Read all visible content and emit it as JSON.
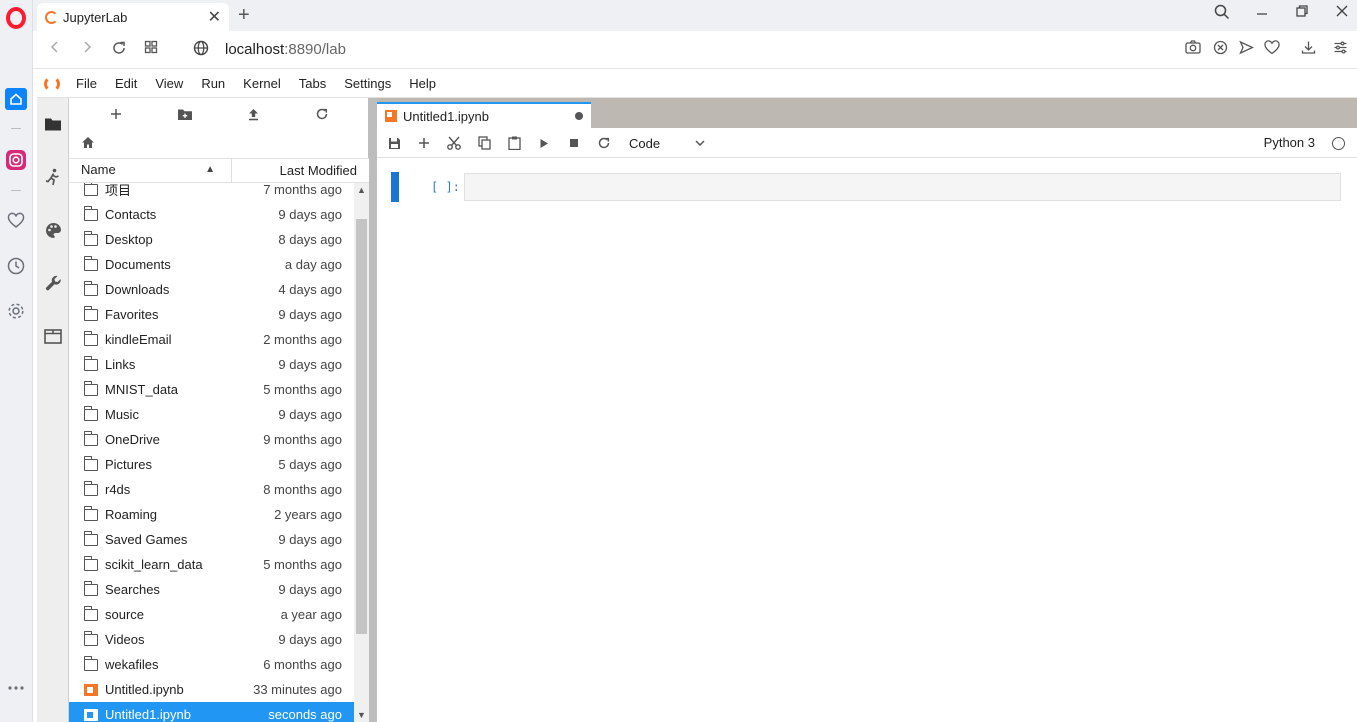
{
  "browser": {
    "tab_title": "JupyterLab",
    "url_host": "localhost",
    "url_rest": ":8890/lab"
  },
  "menubar": {
    "items": [
      "File",
      "Edit",
      "View",
      "Run",
      "Kernel",
      "Tabs",
      "Settings",
      "Help"
    ]
  },
  "filebrowser": {
    "col_name": "Name",
    "col_modified": "Last Modified",
    "rows": [
      {
        "name": "项目",
        "modified": "7 months ago",
        "type": "folder"
      },
      {
        "name": "Contacts",
        "modified": "9 days ago",
        "type": "folder"
      },
      {
        "name": "Desktop",
        "modified": "8 days ago",
        "type": "folder"
      },
      {
        "name": "Documents",
        "modified": "a day ago",
        "type": "folder"
      },
      {
        "name": "Downloads",
        "modified": "4 days ago",
        "type": "folder"
      },
      {
        "name": "Favorites",
        "modified": "9 days ago",
        "type": "folder"
      },
      {
        "name": "kindleEmail",
        "modified": "2 months ago",
        "type": "folder"
      },
      {
        "name": "Links",
        "modified": "9 days ago",
        "type": "folder"
      },
      {
        "name": "MNIST_data",
        "modified": "5 months ago",
        "type": "folder"
      },
      {
        "name": "Music",
        "modified": "9 days ago",
        "type": "folder"
      },
      {
        "name": "OneDrive",
        "modified": "9 months ago",
        "type": "folder"
      },
      {
        "name": "Pictures",
        "modified": "5 days ago",
        "type": "folder"
      },
      {
        "name": "r4ds",
        "modified": "8 months ago",
        "type": "folder"
      },
      {
        "name": "Roaming",
        "modified": "2 years ago",
        "type": "folder"
      },
      {
        "name": "Saved Games",
        "modified": "9 days ago",
        "type": "folder"
      },
      {
        "name": "scikit_learn_data",
        "modified": "5 months ago",
        "type": "folder"
      },
      {
        "name": "Searches",
        "modified": "9 days ago",
        "type": "folder"
      },
      {
        "name": "source",
        "modified": "a year ago",
        "type": "folder"
      },
      {
        "name": "Videos",
        "modified": "9 days ago",
        "type": "folder"
      },
      {
        "name": "wekafiles",
        "modified": "6 months ago",
        "type": "folder"
      },
      {
        "name": "Untitled.ipynb",
        "modified": "33 minutes ago",
        "type": "notebook"
      },
      {
        "name": "Untitled1.ipynb",
        "modified": "seconds ago",
        "type": "notebook",
        "selected": true
      }
    ]
  },
  "notebook": {
    "tab_title": "Untitled1.ipynb",
    "cell_type": "Code",
    "kernel": "Python 3",
    "cell_prompt": "[ ]:"
  },
  "colors": {
    "accent": "#2196f3",
    "jupyter_orange": "#f37726",
    "opera_red": "#ff1b2d"
  }
}
